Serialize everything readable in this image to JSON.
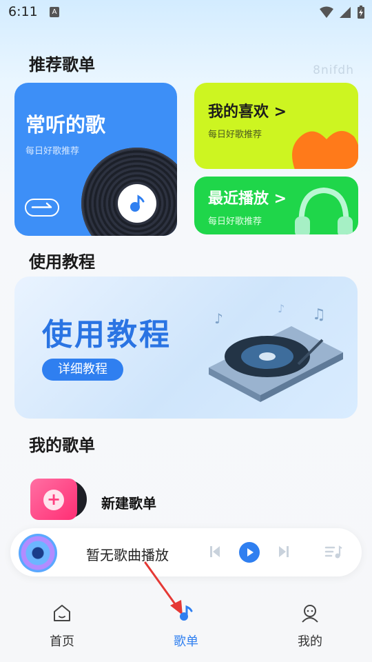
{
  "status_bar": {
    "time": "6:11",
    "indicator": "A"
  },
  "watermark": "8nifdh",
  "recommend": {
    "title": "推荐歌单",
    "frequent": {
      "title": "常听的歌",
      "subtitle": "每日好歌推荐"
    },
    "favorites": {
      "title": "我的喜欢 >",
      "subtitle": "每日好歌推荐"
    },
    "recent": {
      "title": "最近播放 >",
      "subtitle": "每日好歌推荐"
    }
  },
  "tutorial": {
    "title": "使用教程",
    "banner_title": "使用教程",
    "button_label": "详细教程"
  },
  "my_playlists": {
    "title": "我的歌单",
    "new_playlist_label": "新建歌单"
  },
  "player": {
    "now_playing": "暂无歌曲播放"
  },
  "nav": {
    "items": [
      "首页",
      "歌单",
      "我的"
    ],
    "active": "歌单"
  },
  "colors": {
    "accent": "#2f7ff0",
    "frequent_card": "#3d8ff7",
    "favorites_card": "#cdf521",
    "recent_card": "#1fd64a",
    "pink": "#ff2e74",
    "annotation_arrow": "#e53935"
  }
}
